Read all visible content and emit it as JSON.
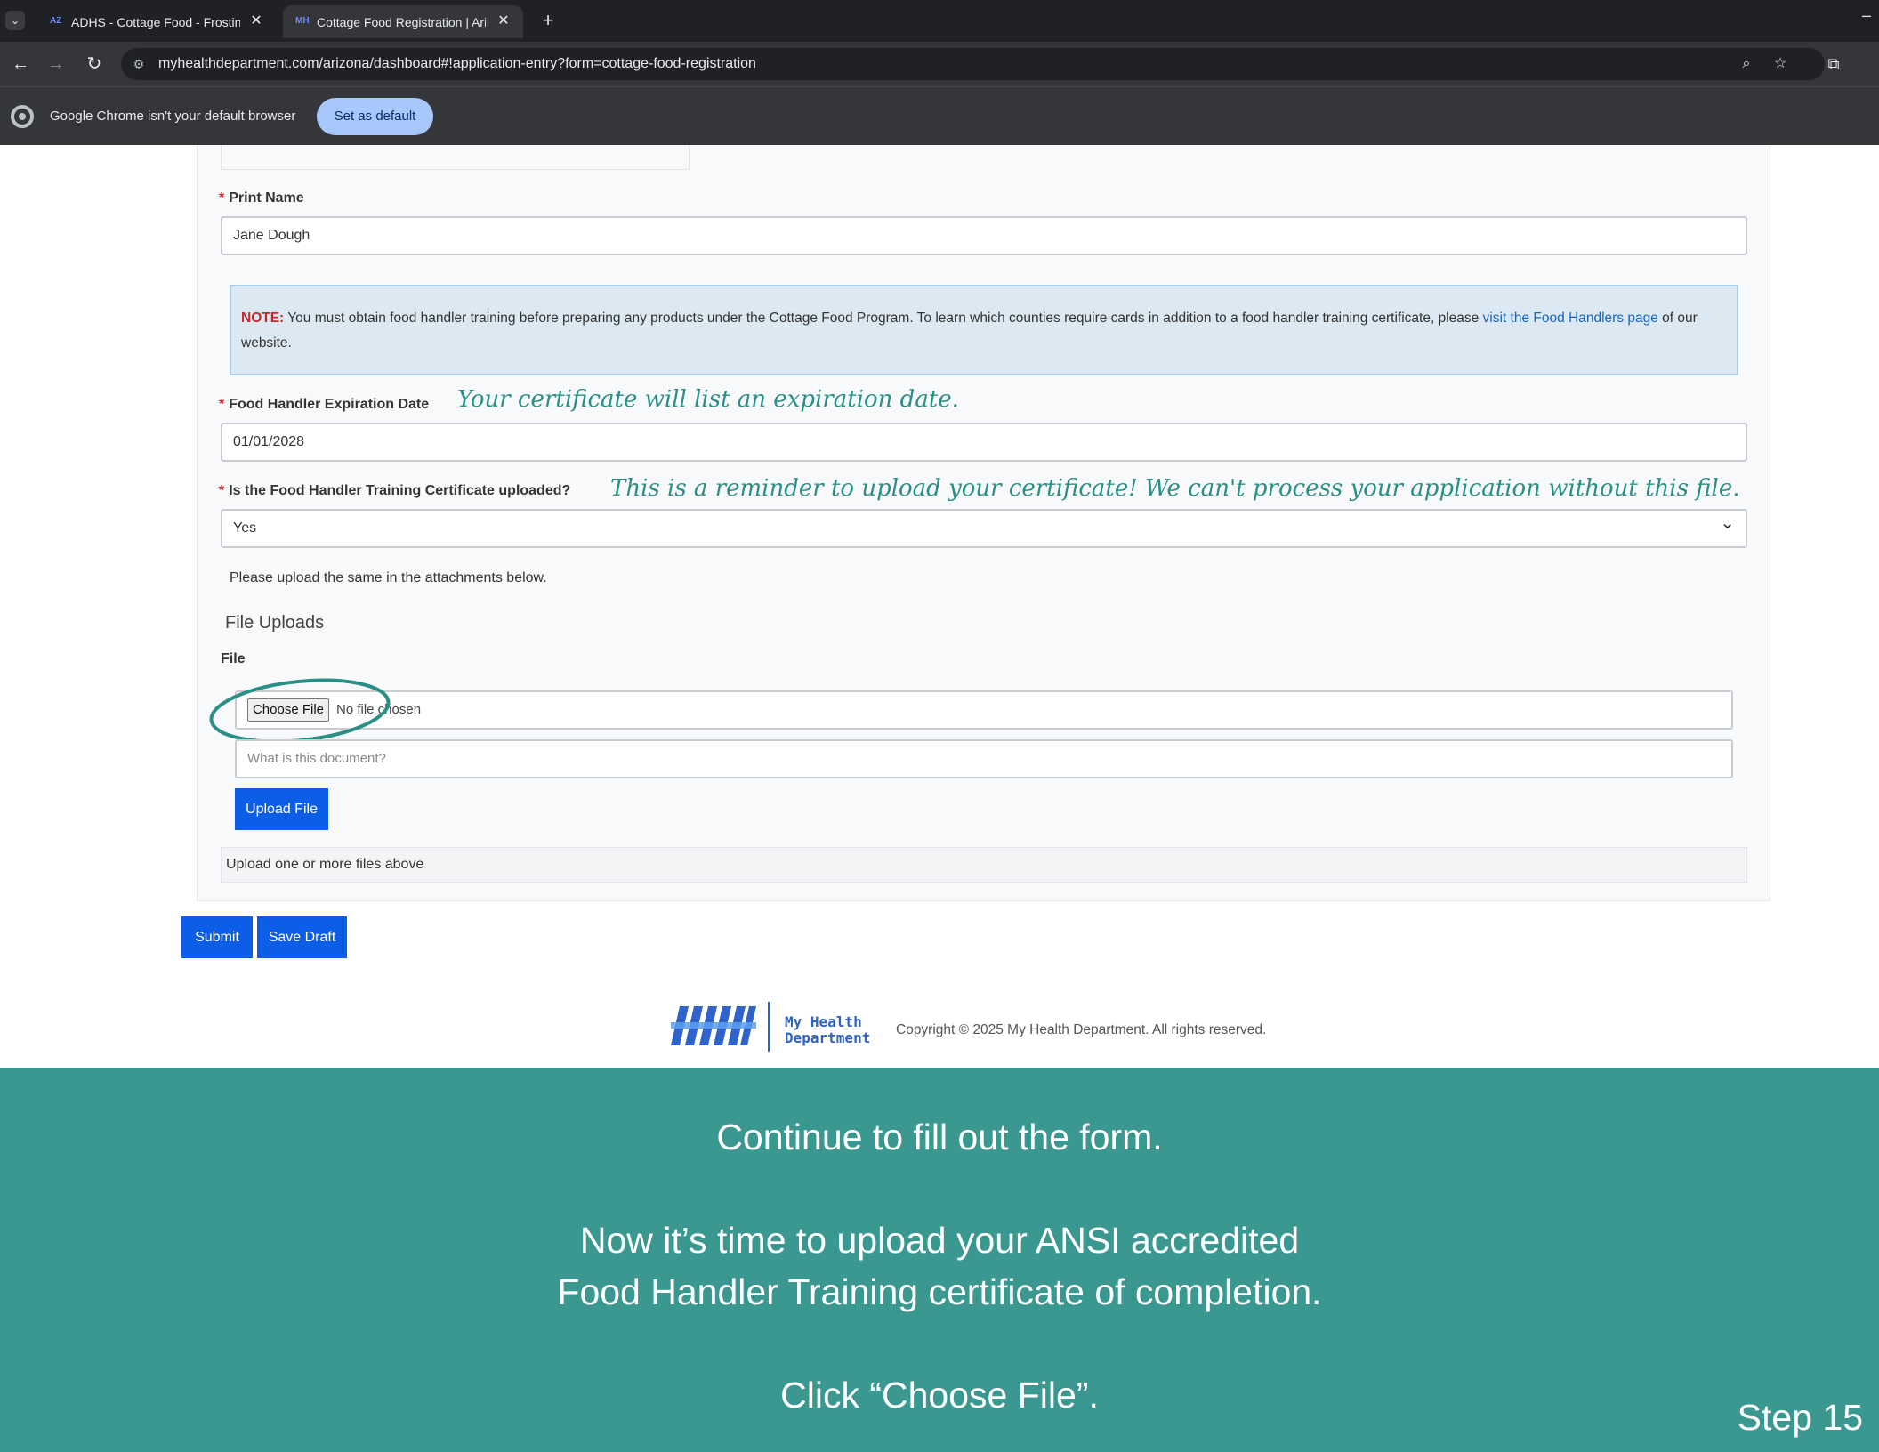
{
  "browser": {
    "tabs": [
      {
        "title": "ADHS - Cottage Food - Frosting",
        "favicon": "AZ",
        "active": false
      },
      {
        "title": "Cottage Food Registration | Arizona",
        "favicon": "MH",
        "active": true
      }
    ],
    "url": "myhealthdepartment.com/arizona/dashboard#!application-entry?form=cottage-food-registration",
    "infobar": {
      "message": "Google Chrome isn't your default browser",
      "button": "Set as default"
    }
  },
  "form": {
    "print_name": {
      "label": "Print Name",
      "value": "Jane Dough"
    },
    "note": {
      "tag": "NOTE:",
      "text": " You must obtain food handler training before preparing any products under the Cottage Food Program. To learn which counties require cards in addition to a food handler training certificate, please ",
      "link": "visit the Food Handlers page",
      "tail": " of our website."
    },
    "expiration": {
      "label": "Food Handler Expiration Date",
      "value": "01/01/2028"
    },
    "certificate_uploaded": {
      "label": "Is the Food Handler Training Certificate uploaded?",
      "value": "Yes"
    },
    "upload_hint": "Please upload the same in the attachments below.",
    "file_uploads": {
      "title": "File Uploads",
      "file_label": "File",
      "choose_button": "Choose File",
      "no_file": "No file chosen",
      "description_placeholder": "What is this document?",
      "upload_button": "Upload File",
      "empty_message": "Upload one or more files above"
    },
    "submit_button": "Submit",
    "save_draft_button": "Save Draft"
  },
  "annotations": {
    "expiration": "Your certificate will list an expiration date.",
    "certificate": "This is a reminder to upload your certificate! We can't process your application without this file."
  },
  "footer": {
    "logo_line1": "My Health",
    "logo_line2": "Department",
    "copyright": "Copyright © 2025 My Health Department. All rights reserved."
  },
  "instructions": {
    "line1": "Continue to fill out the form.",
    "line2": "Now it’s time to upload your ANSI accredited",
    "line3": "Food Handler Training certificate of completion.",
    "line4": "Click “Choose File”.",
    "step": "Step 15"
  },
  "colors": {
    "accent_blue": "#0d5ee6",
    "band_teal": "#3a9890",
    "annotation_teal": "#2a8f86",
    "required_red": "#d32f2f"
  }
}
